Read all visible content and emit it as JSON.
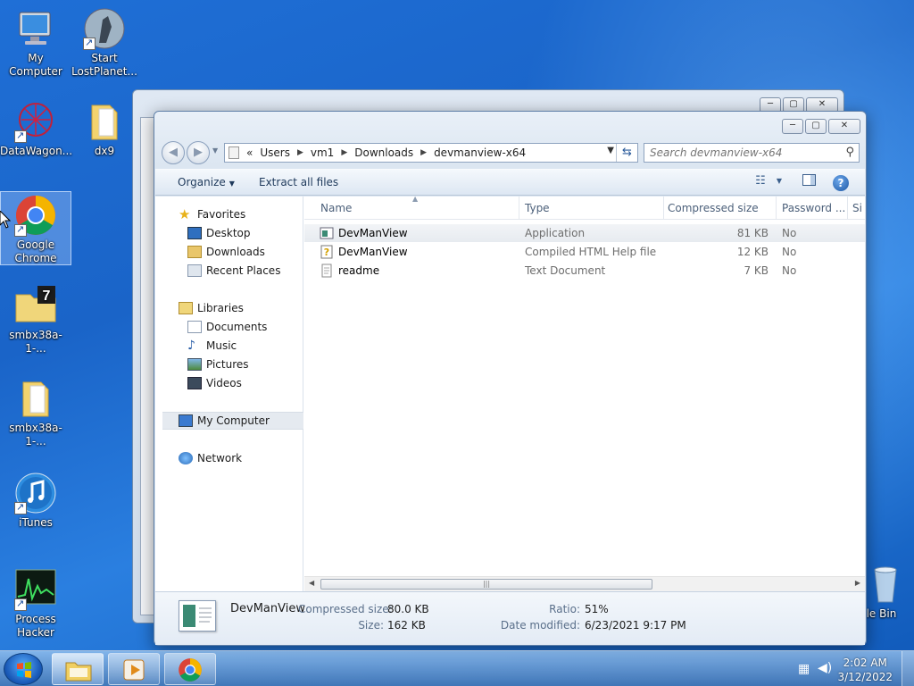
{
  "desktop": {
    "icons": [
      {
        "label": "My Computer"
      },
      {
        "label": "Start LostPlanet..."
      },
      {
        "label": "DataWagon..."
      },
      {
        "label": "dx9"
      },
      {
        "label": "Google Chrome"
      },
      {
        "label": "smbx38a-1-..."
      },
      {
        "label": "smbx38a-1-..."
      },
      {
        "label": "iTunes"
      },
      {
        "label": "Process Hacker"
      },
      {
        "label": "cle Bin"
      }
    ]
  },
  "explorer": {
    "caption_buttons": {
      "minimize": "─",
      "maximize": "▢",
      "close": "✕"
    },
    "breadcrumb": [
      "«",
      "Users",
      "vm1",
      "Downloads",
      "devmanview-x64"
    ],
    "search_placeholder": "Search devmanview-x64",
    "toolbar": {
      "organize": "Organize",
      "extract": "Extract all files"
    },
    "nav": {
      "favorites": "Favorites",
      "desktop": "Desktop",
      "downloads": "Downloads",
      "recent": "Recent Places",
      "libraries": "Libraries",
      "documents": "Documents",
      "music": "Music",
      "pictures": "Pictures",
      "videos": "Videos",
      "computer": "My Computer",
      "network": "Network"
    },
    "columns": {
      "name": "Name",
      "type": "Type",
      "compressed": "Compressed size",
      "password": "Password ...",
      "size": "Si"
    },
    "files": [
      {
        "name": "DevManView",
        "type": "Application",
        "compressed": "81 KB",
        "password": "No",
        "icon": "application-icon"
      },
      {
        "name": "DevManView",
        "type": "Compiled HTML Help file",
        "compressed": "12 KB",
        "password": "No",
        "icon": "help-file-icon"
      },
      {
        "name": "readme",
        "type": "Text Document",
        "compressed": "7 KB",
        "password": "No",
        "icon": "text-document-icon"
      }
    ],
    "details": {
      "name": "DevManView",
      "compressed_label": "Compressed size:",
      "compressed_value": "80.0 KB",
      "size_label": "Size:",
      "size_value": "162 KB",
      "ratio_label": "Ratio:",
      "ratio_value": "51%",
      "date_label": "Date modified:",
      "date_value": "6/23/2021 9:17 PM"
    }
  },
  "taskbar": {
    "time": "2:02 AM",
    "date": "3/12/2022"
  },
  "colors": {
    "desktop": "#1f6fd6",
    "selection": "#e5eaf0",
    "link_text": "#1e395b"
  }
}
